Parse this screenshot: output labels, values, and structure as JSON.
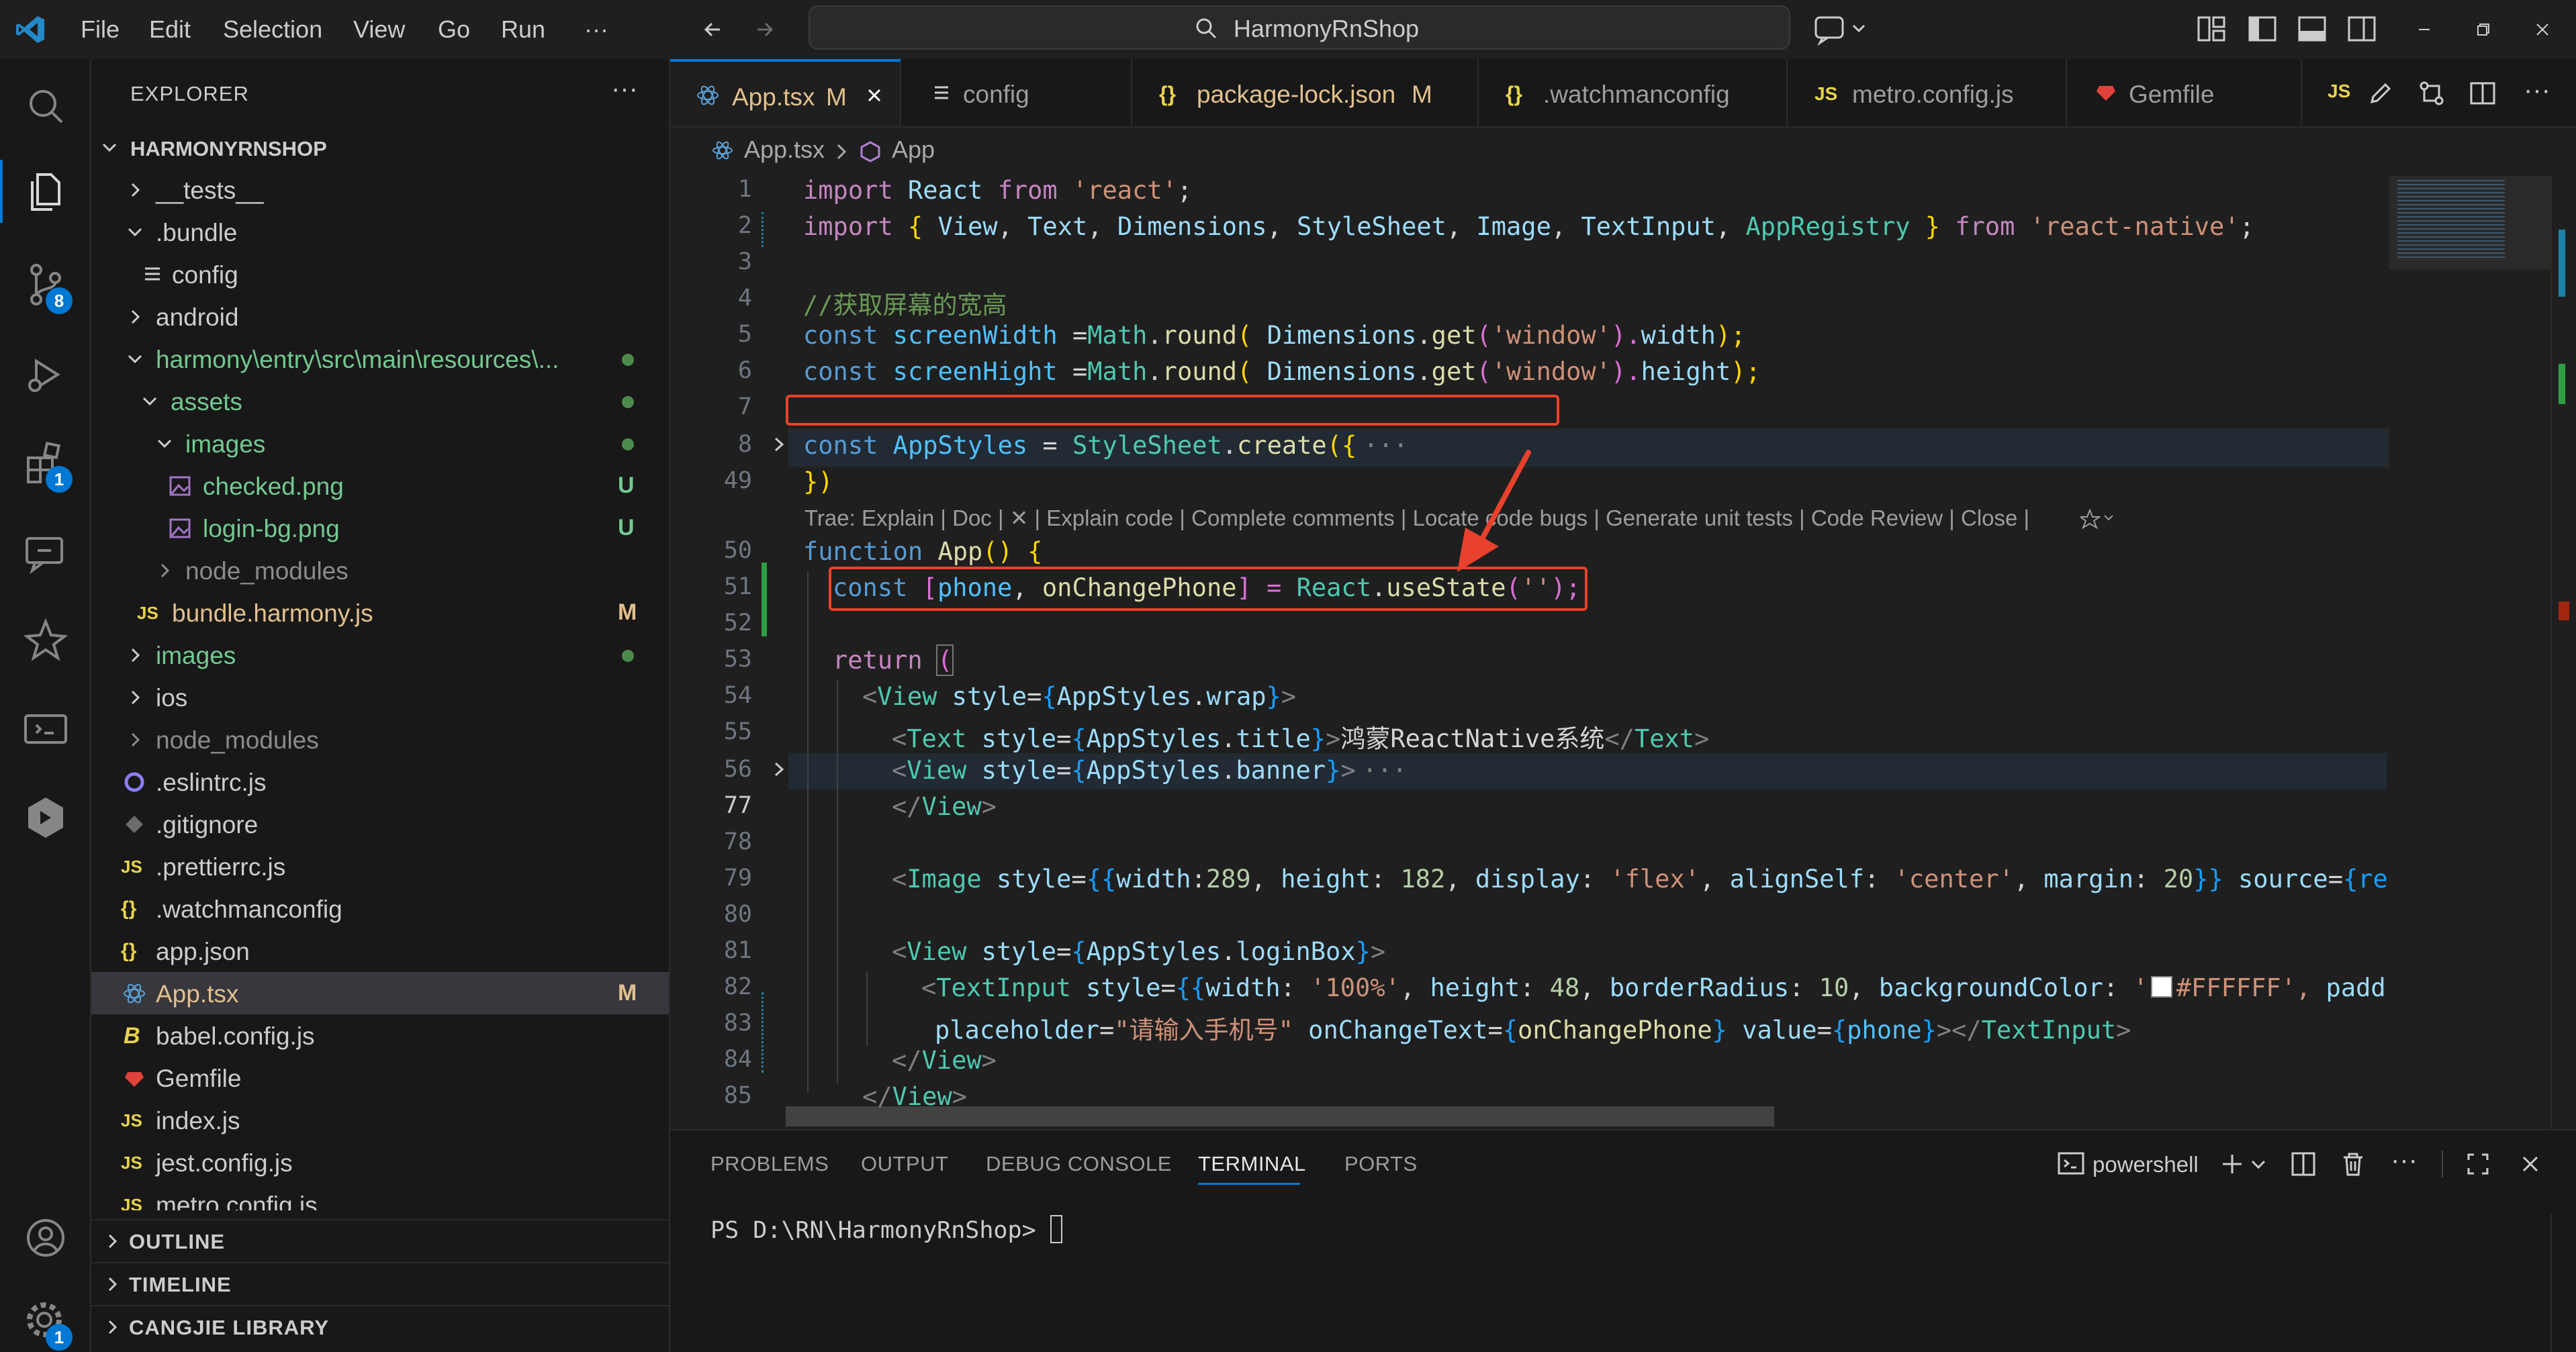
{
  "window": {
    "search_text": "HarmonyRnShop"
  },
  "menu": [
    "File",
    "Edit",
    "Selection",
    "View",
    "Go",
    "Run",
    "···"
  ],
  "activity": {
    "scm_badge": "8",
    "extensions_badge": "1",
    "settings_badge": "1"
  },
  "explorer": {
    "title": "EXPLORER",
    "more": "···",
    "root": "HARMONYRNSHOP",
    "items": [
      {
        "label": "__tests__"
      },
      {
        "label": ".bundle"
      },
      {
        "label": "config"
      },
      {
        "label": "android"
      },
      {
        "label": "harmony\\entry\\src\\main\\resources\\..."
      },
      {
        "label": "assets"
      },
      {
        "label": "images"
      },
      {
        "label": "checked.png",
        "status": "U"
      },
      {
        "label": "login-bg.png",
        "status": "U"
      },
      {
        "label": "node_modules"
      },
      {
        "label": "bundle.harmony.js",
        "status": "M"
      },
      {
        "label": "images"
      },
      {
        "label": "ios"
      },
      {
        "label": "node_modules"
      },
      {
        "label": ".eslintrc.js"
      },
      {
        "label": ".gitignore"
      },
      {
        "label": ".prettierrc.js"
      },
      {
        "label": ".watchmanconfig"
      },
      {
        "label": "app.json"
      },
      {
        "label": "App.tsx",
        "status": "M"
      },
      {
        "label": "babel.config.js"
      },
      {
        "label": "Gemfile"
      },
      {
        "label": "index.js"
      },
      {
        "label": "jest.config.js"
      },
      {
        "label": "metro.config.js"
      }
    ],
    "sections": [
      "OUTLINE",
      "TIMELINE",
      "CANGJIE LIBRARY"
    ]
  },
  "tabs": [
    {
      "label": "App.tsx",
      "modified": "M",
      "icon": "react-icon"
    },
    {
      "label": "config",
      "icon": "lines-icon"
    },
    {
      "label": "package-lock.json",
      "modified": "M",
      "icon": "braces-icon"
    },
    {
      "label": ".watchmanconfig",
      "icon": "braces-icon"
    },
    {
      "label": "metro.config.js",
      "icon": "js-icon"
    },
    {
      "label": "Gemfile",
      "icon": "ruby-icon"
    }
  ],
  "breadcrumb": [
    "App.tsx",
    "App"
  ],
  "editor": {
    "line_numbers": [
      "1",
      "2",
      "3",
      "4",
      "5",
      "6",
      "7",
      "8",
      "49",
      "50",
      "51",
      "52",
      "53",
      "54",
      "55",
      "56",
      "77",
      "78",
      "79",
      "80",
      "81",
      "82",
      "83",
      "84",
      "85"
    ],
    "codelens": "Trae: Explain | Doc | ✕ | Explain code | Complete comments | Locate code bugs | Generate unit tests | Code Review | Close |",
    "lines": {
      "l1": [
        "import",
        " React ",
        "from",
        " ",
        "'react'",
        ";"
      ],
      "l2": [
        "import",
        " { ",
        "View",
        ", ",
        "Text",
        ", ",
        "Dimensions",
        ", ",
        "StyleSheet",
        ", ",
        "Image",
        ", ",
        "TextInput",
        ", ",
        "AppRegistry",
        " } ",
        "from",
        " ",
        "'react-native'",
        ";"
      ],
      "l4": [
        "//获取屏幕的宽高"
      ],
      "l5": [
        "const",
        " ",
        "screenWidth",
        " =",
        "Math",
        ".",
        "round",
        "( ",
        "Dimensions",
        ".",
        "get",
        "(",
        "'window'",
        ").",
        "width",
        ");"
      ],
      "l6": [
        "const",
        " ",
        "screenHight",
        " =",
        "Math",
        ".",
        "round",
        "( ",
        "Dimensions",
        ".",
        "get",
        "(",
        "'window'",
        ").",
        "height",
        ");"
      ],
      "l8": [
        "const",
        " ",
        "AppStyles",
        " = ",
        "StyleSheet",
        ".",
        "create",
        "({",
        "···"
      ],
      "l49": [
        "})"
      ],
      "l50": [
        "function",
        " ",
        "App",
        "() {"
      ],
      "l51": [
        "const",
        " [",
        "phone",
        ", ",
        "onChangePhone",
        "] = ",
        "React",
        ".",
        "useState",
        "(",
        "''",
        ");"
      ],
      "l53": [
        "return",
        " ",
        "("
      ],
      "l54": [
        "<",
        "View",
        " ",
        "style",
        "=",
        "{",
        "AppStyles",
        ".",
        "wrap",
        "}",
        ">"
      ],
      "l55": [
        "<",
        "Text",
        " ",
        "style",
        "=",
        "{",
        "AppStyles",
        ".",
        "title",
        "}",
        ">",
        "鸿蒙ReactNative系统",
        "</",
        "Text",
        ">"
      ],
      "l56": [
        "<",
        "View",
        " ",
        "style",
        "=",
        "{",
        "AppStyles",
        ".",
        "banner",
        "}",
        ">",
        "···"
      ],
      "l77": [
        "</",
        "View",
        ">"
      ],
      "l79": [
        "<",
        "Image",
        " ",
        "style",
        "=",
        "{{",
        "width",
        ":",
        "289",
        ", ",
        "height",
        ": ",
        "182",
        ", ",
        "display",
        ": ",
        "'flex'",
        ", ",
        "alignSelf",
        ": ",
        "'center'",
        ", ",
        "margin",
        ": ",
        "20",
        "}}",
        " ",
        "source",
        "=",
        "{req"
      ],
      "l81": [
        "<",
        "View",
        " ",
        "style",
        "=",
        "{",
        "AppStyles",
        ".",
        "loginBox",
        "}",
        ">"
      ],
      "l82": [
        "<",
        "TextInput",
        " ",
        "style",
        "=",
        "{{",
        "width",
        ": ",
        "'100%'",
        ", ",
        "height",
        ": ",
        "48",
        ", ",
        "borderRadius",
        ": ",
        "10",
        ", ",
        "backgroundColor",
        ": ",
        "'",
        "#FFFFFF",
        "', ",
        "padd"
      ],
      "l83": [
        "placeholder",
        "=",
        "\"请输入手机号\"",
        " ",
        "onChangeText",
        "=",
        "{",
        "onChangePhone",
        "}",
        " ",
        "value",
        "=",
        "{",
        "phone",
        "}",
        "></",
        "TextInput",
        ">"
      ],
      "l84": [
        "</",
        "View",
        ">"
      ],
      "l85": [
        "</",
        "View",
        ">"
      ]
    }
  },
  "panel": {
    "tabs": [
      "PROBLEMS",
      "OUTPUT",
      "DEBUG CONSOLE",
      "TERMINAL",
      "PORTS"
    ],
    "active_tab": "TERMINAL",
    "shell": "powershell",
    "prompt": "PS D:\\RN\\HarmonyRnShop> "
  },
  "colors": {
    "accent": "#0078d4",
    "annotation": "#e8412c",
    "modified": "#e2c08d",
    "untracked": "#73c991"
  }
}
